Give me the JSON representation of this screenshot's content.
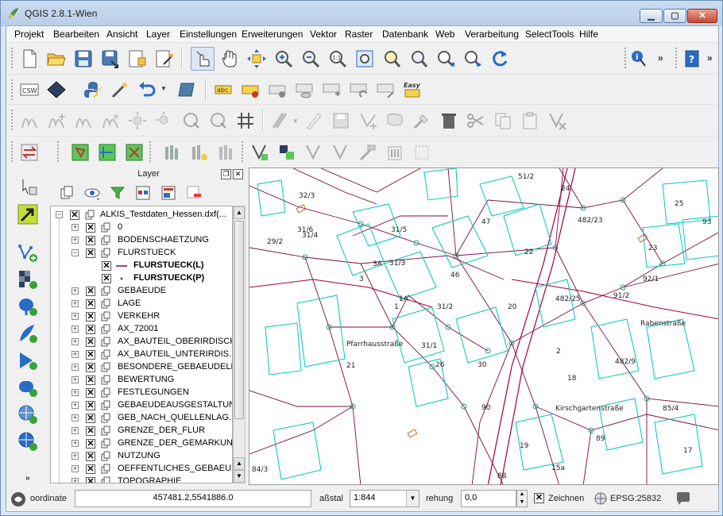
{
  "window": {
    "title": "QGIS 2.8.1-Wien"
  },
  "menu": [
    "Projekt",
    "Bearbeiten",
    "Ansicht",
    "Layer",
    "Einstellungen",
    "Erweiterungen",
    "Vektor",
    "Raster",
    "Datenbank",
    "Web",
    "Verarbeitung",
    "SelectTools",
    "Hilfe"
  ],
  "toolbar_labels": {
    "csw": "CSW",
    "easy": "Easy",
    "abc": "abc"
  },
  "layers_panel": {
    "title": "Layer",
    "root": "ALKIS_Testdaten_Hessen.dxf(...",
    "items": [
      "0",
      "BODENSCHAETZUNG",
      "FLURSTUECK",
      "FLURSTUECK(L)",
      "FLURSTUECK(P)",
      "GEBAEUDE",
      "LAGE",
      "VERKEHR",
      "AX_72001",
      "AX_BAUTEIL_OBERIRDISCH",
      "AX_BAUTEIL_UNTERIRDIS...",
      "BESONDERE_GEBAEUDELI...",
      "BEWERTUNG",
      "FESTLEGUNGEN",
      "GEBAEUDEAUSGESTALTUNG",
      "GEB_NACH_QUELLENLAG...",
      "GRENZE_DER_FLUR",
      "GRENZE_DER_GEMARKUNG",
      "NUTZUNG",
      "OEFFENTLICHES_GEBAEU...",
      "TOPOGRAPHIE"
    ]
  },
  "map": {
    "labels": [
      "51/2",
      "24",
      "32/3",
      "25",
      "93",
      "482/23",
      "47",
      "31/6",
      "31/5",
      "29/2",
      "31/4",
      "22",
      "23",
      "3A",
      "31/3",
      "46",
      "92/1",
      "3",
      "1A",
      "1",
      "31/2",
      "20",
      "482/25",
      "91/2",
      "Rabenstraße",
      "Pfarrhausstraße",
      "31/1",
      "2",
      "482/9",
      "21",
      "26",
      "30",
      "18",
      "90",
      "Kirschgartenstraße",
      "85/4",
      "89",
      "19",
      "17",
      "88",
      "15a",
      "84/3",
      "14a"
    ]
  },
  "statusbar": {
    "coord_label": "oordinate",
    "coord_value": "457481.2,5541886.0",
    "scale_label": "aßstal",
    "scale_value": "1:844",
    "rotation_label": "rehung",
    "rotation_value": "0,0",
    "render_label": "Zeichnen",
    "crs": "EPSG:25832"
  },
  "colors": {
    "parcel": "#7a0a3c",
    "building": "#00c4c4",
    "road": "#a0003c",
    "selection": "#8aa6c7"
  }
}
